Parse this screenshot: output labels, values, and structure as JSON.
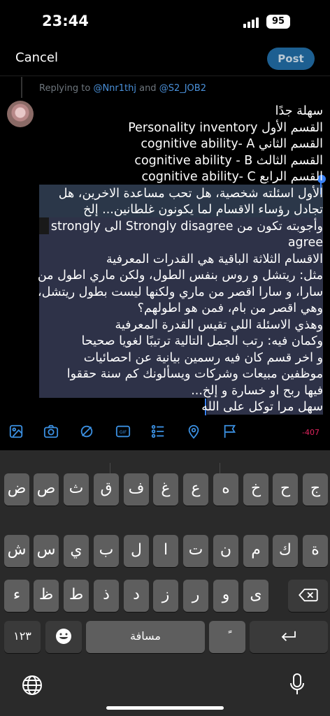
{
  "status_bar": {
    "time": "23:44",
    "battery": "95"
  },
  "header": {
    "cancel_label": "Cancel",
    "post_label": "Post"
  },
  "reply": {
    "prefix": "Replying to ",
    "mention1": "@Nnr1thj",
    "joiner": " and ",
    "mention2": "@S2_JOB2"
  },
  "compose": {
    "lines": [
      "سهلة جدًا",
      "القسم الأول Personality inventory",
      "القسم الثاني cognitive ability- A",
      "القسم الثالث cognitive ability - B",
      "القسم الرابع cognitive ability- C",
      "الأول اسئلته شخصية، هل تحب مساعدة الاخرين، هل",
      "تجادل رؤساء الاقسام لما يكونون غلطانين... إلخ",
      "وأجوبته تكون من Strongly disagree الى strongly",
      "agree",
      "الاقسام الثلاثة الباقية هي القدرات المعرفية",
      "مثل: ريتشل و روس بنفس الطول، ولكن ماري اطول من",
      "سارا، و سارا اقصر من ماري ولكنها ليست بطول ريتشل،",
      "وهي اقصر من بام، فمن هو اطولهم؟",
      "وهذي الاسئلة اللي تقيس القدرة المعرفية",
      "وكمان فيه: رتب الجمل التالية ترتيبًا لغويا صحيحا",
      "و اخر قسم كان فيه رسمين بيانية عن احصائيات",
      "موظفين مبيعات وشركات ويسألونك كم سنة حققوا",
      "فيها ربح او خسارة و إلخ...",
      "سهل مرا توكل على الله"
    ]
  },
  "toolbar": {
    "icons": [
      "image-icon",
      "camera-icon",
      "gif-alt-icon",
      "gif-icon",
      "poll-icon",
      "location-icon",
      "flag-icon"
    ],
    "char_count": "-407"
  },
  "keyboard": {
    "row1": [
      "ض",
      "ص",
      "ث",
      "ق",
      "ف",
      "غ",
      "ع",
      "ه",
      "خ",
      "ح",
      "ج"
    ],
    "row2": [
      "ش",
      "س",
      "ي",
      "ب",
      "ل",
      "ا",
      "ت",
      "ن",
      "م",
      "ك",
      "ة"
    ],
    "row3": [
      "ء",
      "ظ",
      "ط",
      "ذ",
      "د",
      "ز",
      "ر",
      "و",
      "ى"
    ],
    "numbers_label": "١٢٣",
    "space_label": "مسافة",
    "diacritic_label": "ًً"
  },
  "colors": {
    "accent": "#1d9bf0",
    "selection": "#3a4a62",
    "keyboard_bg": "#2a2a2a",
    "key_bg": "#5e5e5e"
  }
}
